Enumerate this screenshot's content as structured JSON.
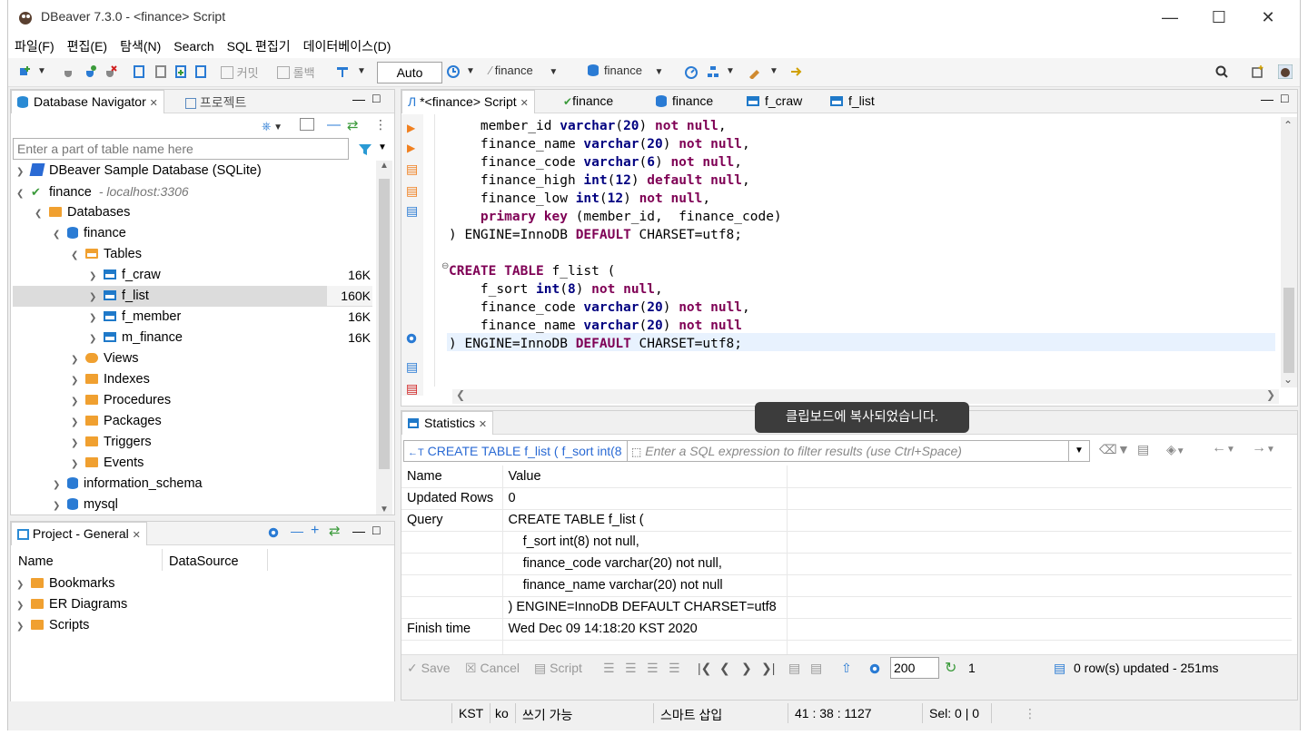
{
  "window": {
    "title": "DBeaver 7.3.0 - <finance> Script"
  },
  "menu": [
    "파일(F)",
    "편집(E)",
    "탐색(N)",
    "Search",
    "SQL 편집기",
    "데이터베이스(D)"
  ],
  "toolbar": {
    "commit": "커밋",
    "rollback": "롤백",
    "mode": "Auto",
    "datasource": "finance",
    "schema": "finance"
  },
  "navigator": {
    "tab_label": "Database Navigator",
    "project_tab_label": "프로젝트",
    "filter_placeholder": "Enter a part of table name here",
    "items": [
      {
        "label": "DBeaver Sample Database (SQLite)"
      },
      {
        "label": "finance",
        "host": "- localhost:3306"
      },
      {
        "label": "Databases"
      },
      {
        "label": "finance"
      },
      {
        "label": "Tables"
      },
      {
        "label": "f_craw",
        "size": "16K"
      },
      {
        "label": "f_list",
        "size": "160K"
      },
      {
        "label": "f_member",
        "size": "16K"
      },
      {
        "label": "m_finance",
        "size": "16K"
      },
      {
        "label": "Views"
      },
      {
        "label": "Indexes"
      },
      {
        "label": "Procedures"
      },
      {
        "label": "Packages"
      },
      {
        "label": "Triggers"
      },
      {
        "label": "Events"
      },
      {
        "label": "information_schema"
      },
      {
        "label": "mysql"
      }
    ]
  },
  "project": {
    "tab_label": "Project - General",
    "col_name": "Name",
    "col_datasource": "DataSource",
    "items": [
      "Bookmarks",
      "ER Diagrams",
      "Scripts"
    ]
  },
  "editor": {
    "tabs": [
      "*<finance> Script",
      "finance",
      "finance",
      "f_craw",
      "f_list"
    ]
  },
  "results": {
    "tab_label": "Statistics",
    "query_preview": "CREATE TABLE f_list ( f_sort int(8",
    "filter_placeholder": "Enter a SQL expression to filter results (use Ctrl+Space)",
    "col_name": "Name",
    "col_value": "Value",
    "rows": [
      {
        "name": "Updated Rows",
        "value": "0"
      },
      {
        "name": "Query",
        "value": "CREATE TABLE f_list ("
      },
      {
        "name": "",
        "value": "    f_sort int(8) not null,"
      },
      {
        "name": "",
        "value": "    finance_code varchar(20) not null,"
      },
      {
        "name": "",
        "value": "    finance_name varchar(20) not null"
      },
      {
        "name": "",
        "value": ") ENGINE=InnoDB DEFAULT CHARSET=utf8"
      },
      {
        "name": "Finish time",
        "value": "Wed Dec 09 14:18:20 KST 2020"
      }
    ],
    "save": "Save",
    "cancel": "Cancel",
    "script": "Script",
    "fetch_size": "200",
    "refresh_count": "1",
    "status_msg": "0 row(s) updated - 251ms"
  },
  "tooltip": "클립보드에 복사되었습니다.",
  "status": {
    "tz": "KST",
    "locale": "ko",
    "mode": "쓰기 가능",
    "insert": "스마트 삽입",
    "pos": "41 : 38 : 1127",
    "sel": "Sel: 0 | 0"
  }
}
